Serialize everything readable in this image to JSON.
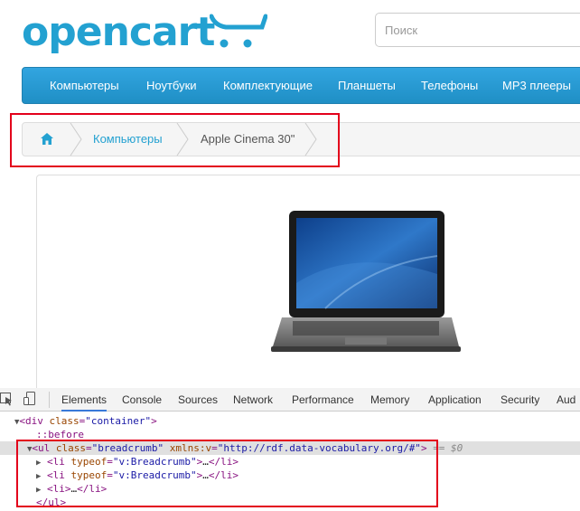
{
  "header": {
    "logo_text": "opencart",
    "search_placeholder": "Поиск"
  },
  "menu": {
    "items": [
      "Компьютеры",
      "Ноутбуки",
      "Комплектующие",
      "Планшеты",
      "Телефоны",
      "MP3 плееры"
    ]
  },
  "breadcrumb": {
    "home_icon": "home-icon",
    "items": [
      "Компьютеры",
      "Apple Cinema 30\""
    ]
  },
  "product": {
    "image": "laptop"
  },
  "devtools": {
    "tabs": [
      "Elements",
      "Console",
      "Sources",
      "Network",
      "Performance",
      "Memory",
      "Application",
      "Security",
      "Aud"
    ],
    "active_tab": "Elements",
    "lines": {
      "container_open": {
        "tag": "div",
        "attr": "class",
        "value": "\"container\""
      },
      "before": "::before",
      "ul_open": {
        "tag": "ul",
        "attr1": "class",
        "value1": "\"breadcrumb\"",
        "attr2": "xmlns:v",
        "value2": "\"http://rdf.data-vocabulary.org/#\"",
        "suffix": "== $0"
      },
      "li1": {
        "tag": "li",
        "attr": "typeof",
        "value": "\"v:Breadcrumb\"",
        "ellipsis": "…",
        "close": "li"
      },
      "li2": {
        "tag": "li",
        "attr": "typeof",
        "value": "\"v:Breadcrumb\"",
        "ellipsis": "…",
        "close": "li"
      },
      "li3": {
        "tag": "li",
        "ellipsis": "…",
        "close": "li"
      },
      "ul_close": "ul"
    }
  },
  "colors": {
    "brand": "#23a1d1",
    "highlight": "#e3001b"
  }
}
